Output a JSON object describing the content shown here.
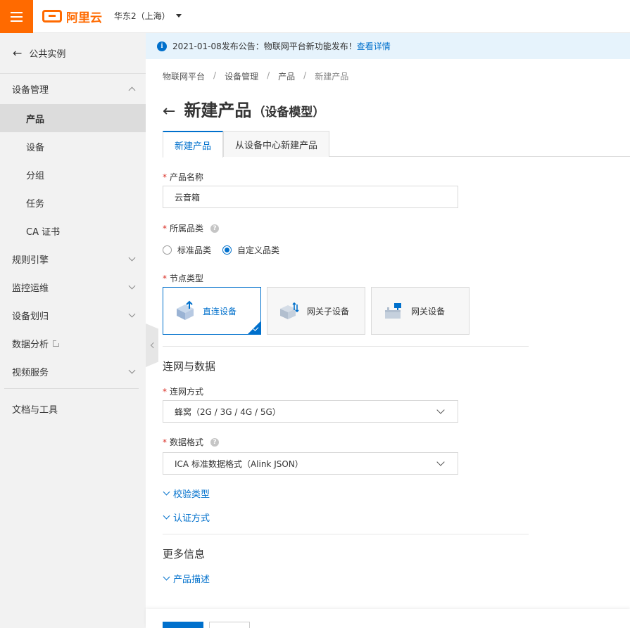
{
  "header": {
    "brand": "阿里云",
    "region": "华东2（上海）"
  },
  "sidebar": {
    "back_label": "公共实例",
    "section": "设备管理",
    "items": [
      {
        "label": "产品",
        "active": true
      },
      {
        "label": "设备"
      },
      {
        "label": "分组"
      },
      {
        "label": "任务"
      },
      {
        "label": "CA 证书"
      }
    ],
    "groups": [
      {
        "label": "规则引擎"
      },
      {
        "label": "监控运维"
      },
      {
        "label": "设备划归"
      },
      {
        "label": "数据分析"
      },
      {
        "label": "视频服务"
      }
    ],
    "docs": "文档与工具"
  },
  "announcement": {
    "text": "2021-01-08发布公告：物联网平台新功能发布！",
    "link": "查看详情"
  },
  "breadcrumb": [
    "物联网平台",
    "设备管理",
    "产品",
    "新建产品"
  ],
  "page": {
    "title": "新建产品",
    "subtitle": "（设备模型）"
  },
  "tabs": [
    {
      "label": "新建产品",
      "active": true
    },
    {
      "label": "从设备中心新建产品"
    }
  ],
  "form": {
    "product_name_label": "产品名称",
    "product_name_value": "云音箱",
    "category_label": "所属品类",
    "category_options": [
      "标准品类",
      "自定义品类"
    ],
    "category_selected": "自定义品类",
    "node_type_label": "节点类型",
    "node_types": [
      {
        "label": "直连设备",
        "active": true
      },
      {
        "label": "网关子设备"
      },
      {
        "label": "网关设备"
      }
    ],
    "section_network": "连网与数据",
    "network_label": "连网方式",
    "network_value": "蜂窝（2G / 3G / 4G / 5G）",
    "data_format_label": "数据格式",
    "data_format_value": "ICA 标准数据格式（Alink JSON）",
    "validation_type": "校验类型",
    "auth_method": "认证方式",
    "section_more": "更多信息",
    "product_desc": "产品描述"
  },
  "colors": {
    "brand": "#ff6a00",
    "primary": "#0070cc",
    "required": "#d93026"
  }
}
